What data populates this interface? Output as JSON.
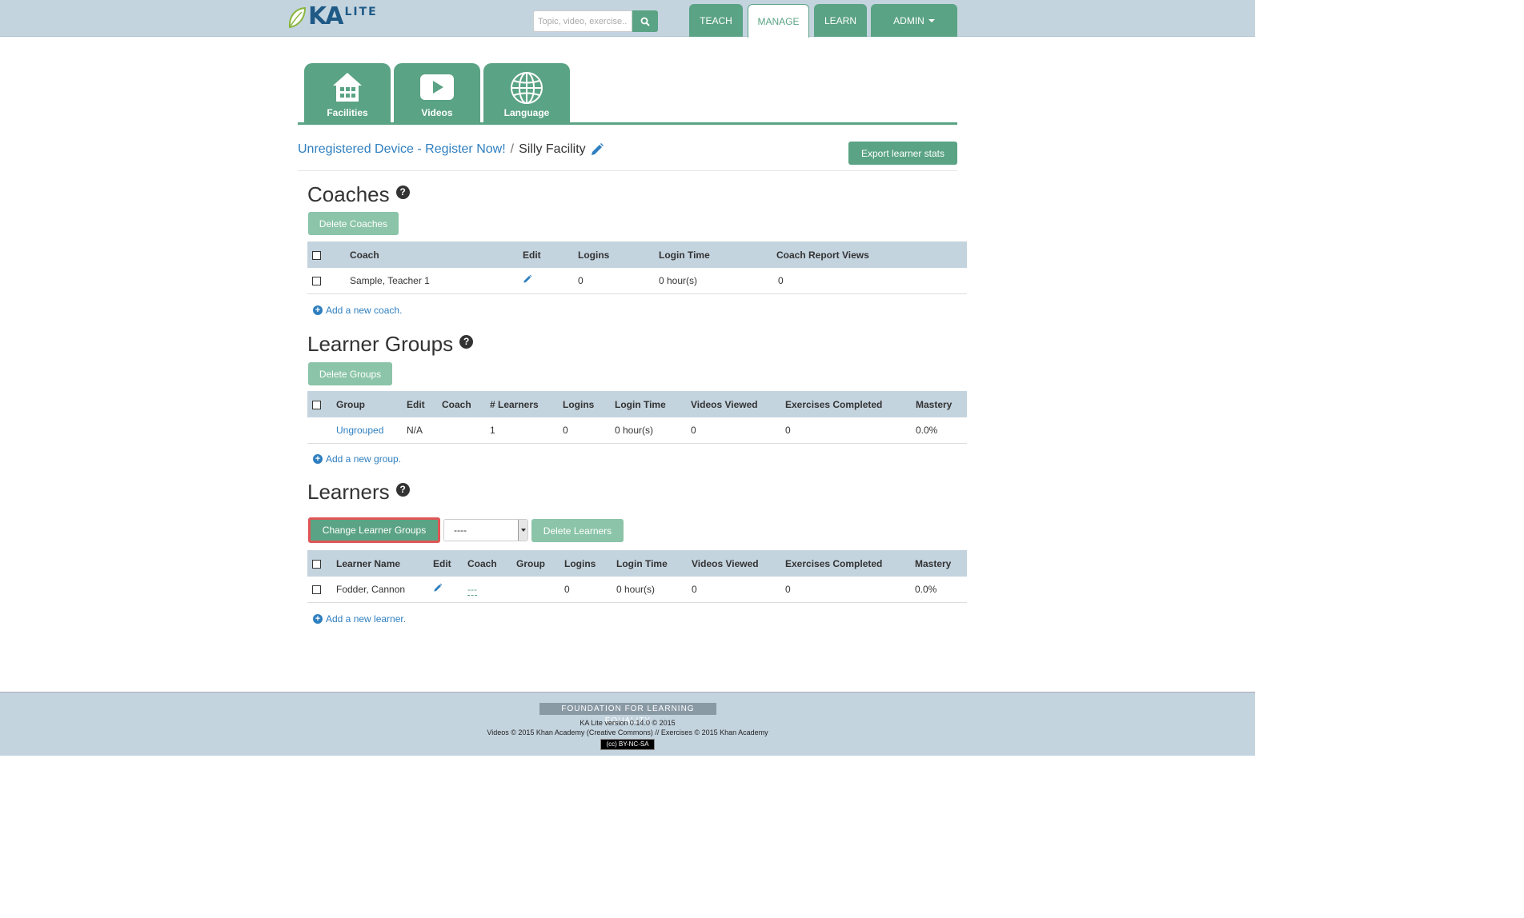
{
  "app": {
    "logo_ka": "KA",
    "logo_lite": "LITE"
  },
  "header": {
    "search_placeholder": "Topic, video, exercise...",
    "nav": [
      {
        "label": "TEACH"
      },
      {
        "label": "MANAGE"
      },
      {
        "label": "LEARN"
      },
      {
        "label": "ADMIN"
      }
    ]
  },
  "manage_tabs": [
    {
      "label": "Facilities",
      "icon": "house-icon"
    },
    {
      "label": "Videos",
      "icon": "play-icon"
    },
    {
      "label": "Language",
      "icon": "globe-icon"
    }
  ],
  "breadcrumb": {
    "device": "Unregistered Device - Register Now!",
    "separator": "/",
    "facility": "Silly Facility"
  },
  "export_button": "Export learner stats",
  "coaches": {
    "title": "Coaches",
    "delete_button": "Delete Coaches",
    "columns": [
      "Coach",
      "Edit",
      "Logins",
      "Login Time",
      "Coach Report Views"
    ],
    "rows": [
      {
        "coach": "Sample, Teacher 1",
        "logins": "0",
        "login_time": "0 hour(s)",
        "report_views": "0"
      }
    ],
    "add_link": "Add a new coach."
  },
  "groups": {
    "title": "Learner Groups",
    "delete_button": "Delete Groups",
    "columns": [
      "Group",
      "Edit",
      "Coach",
      "# Learners",
      "Logins",
      "Login Time",
      "Videos Viewed",
      "Exercises Completed",
      "Mastery"
    ],
    "rows": [
      {
        "group": "Ungrouped",
        "edit": "N/A",
        "coach": "",
        "learners": "1",
        "logins": "0",
        "login_time": "0 hour(s)",
        "videos": "0",
        "exercises": "0",
        "mastery": "0.0%"
      }
    ],
    "add_link": "Add a new group."
  },
  "learners": {
    "title": "Learners",
    "change_button": "Change Learner Groups",
    "group_select_value": "----",
    "delete_button": "Delete Learners",
    "columns": [
      "Learner Name",
      "Edit",
      "Coach",
      "Group",
      "Logins",
      "Login Time",
      "Videos Viewed",
      "Exercises Completed",
      "Mastery"
    ],
    "rows": [
      {
        "name": "Fodder, Cannon",
        "coach": "---",
        "group": "",
        "logins": "0",
        "login_time": "0 hour(s)",
        "videos": "0",
        "exercises": "0",
        "mastery": "0.0%"
      }
    ],
    "add_link": "Add a new learner."
  },
  "footer": {
    "org": "FOUNDATION FOR LEARNING EQUALITY",
    "version": "KA Lite version 0.14.0 © 2015",
    "credits": "Videos © 2015 Khan Academy (Creative Commons) // Exercises © 2015 Khan Academy",
    "license": "BY-NC-SA"
  },
  "colors": {
    "brand_green": "#5aa384",
    "light_green": "#8bc4a8",
    "header_blue": "#c4d4df",
    "link_blue": "#2f7fbf",
    "highlight_red": "#e05555"
  }
}
